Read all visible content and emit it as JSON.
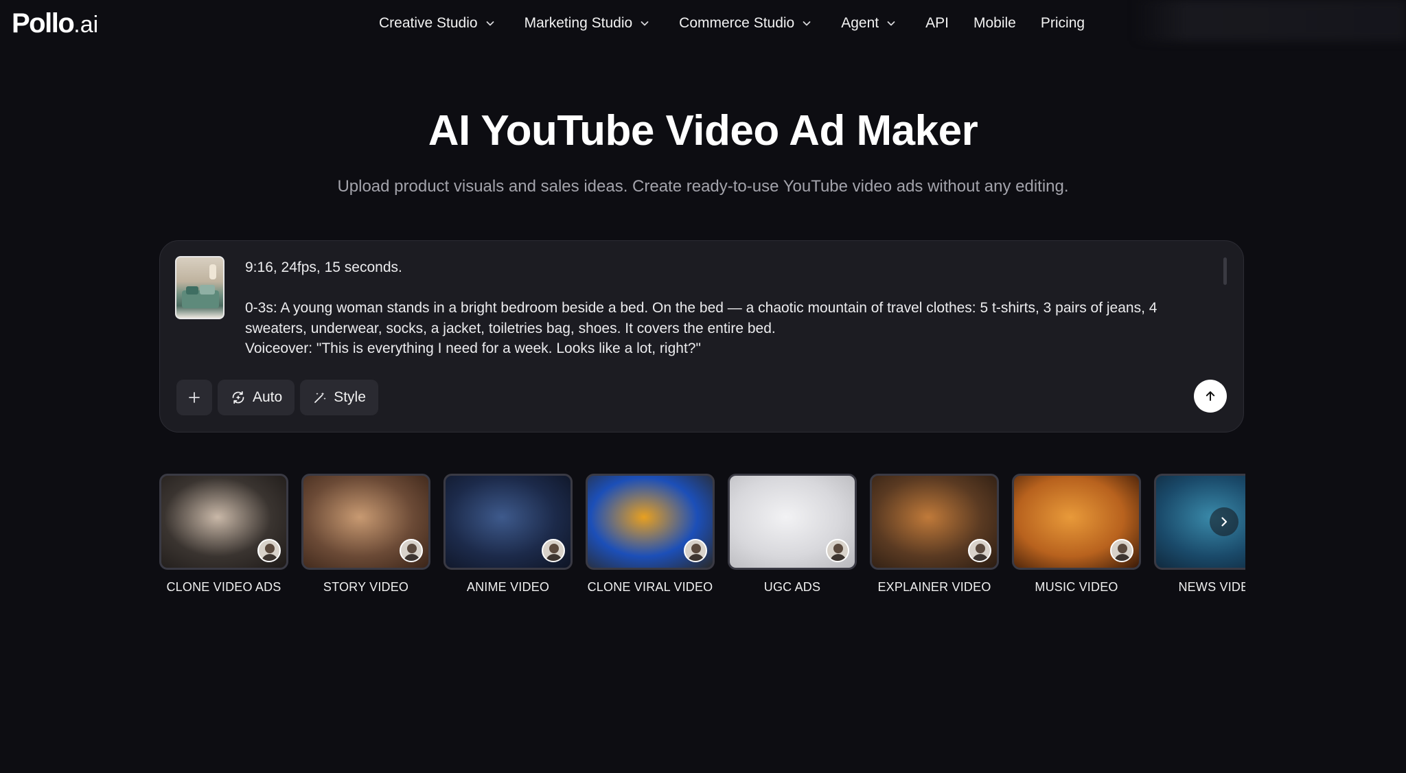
{
  "brand": {
    "name": "Pollo",
    "tld": ".ai"
  },
  "nav": {
    "items": [
      {
        "label": "Creative Studio",
        "dropdown": true
      },
      {
        "label": "Marketing Studio",
        "dropdown": true
      },
      {
        "label": "Commerce Studio",
        "dropdown": true
      },
      {
        "label": "Agent",
        "dropdown": true
      },
      {
        "label": "API",
        "dropdown": false
      },
      {
        "label": "Mobile",
        "dropdown": false
      },
      {
        "label": "Pricing",
        "dropdown": false
      }
    ]
  },
  "hero": {
    "title": "AI YouTube Video Ad Maker",
    "subtitle": "Upload product visuals and sales ideas. Create ready-to-use YouTube video ads without any editing."
  },
  "prompt": {
    "text": "9:16, 24fps, 15 seconds.\n\n0-3s: A young woman stands in a bright bedroom beside a bed. On the bed — a chaotic mountain of travel clothes: 5 t-shirts, 3 pairs of jeans, 4\nsweaters, underwear, socks, a jacket, toiletries bag, shoes. It covers the entire bed.\nVoiceover: \"This is everything I need for a week. Looks like a lot, right?\"",
    "auto_label": "Auto",
    "style_label": "Style"
  },
  "templates": [
    {
      "label": "CLONE VIDEO ADS",
      "colors": [
        "#3a3430",
        "#c9b8a8",
        "#1e1a18"
      ]
    },
    {
      "label": "STORY VIDEO",
      "colors": [
        "#6b4a36",
        "#c89a72",
        "#3a2418"
      ]
    },
    {
      "label": "ANIME VIDEO",
      "colors": [
        "#1c2a4a",
        "#3e5a8c",
        "#0e1424"
      ]
    },
    {
      "label": "CLONE VIRAL VIDEO",
      "colors": [
        "#1c4fb8",
        "#e8a020",
        "#2a2a2a"
      ]
    },
    {
      "label": "UGC ADS",
      "colors": [
        "#d8d8dc",
        "#f2f2f4",
        "#b8b8bc"
      ]
    },
    {
      "label": "EXPLAINER VIDEO",
      "colors": [
        "#5a3a22",
        "#c07a3a",
        "#2a1c12"
      ]
    },
    {
      "label": "MUSIC VIDEO",
      "colors": [
        "#b8621e",
        "#e89a3a",
        "#3a1a08"
      ]
    },
    {
      "label": "NEWS VIDEO",
      "colors": [
        "#1a4a6a",
        "#3a8aaa",
        "#0e2234"
      ]
    }
  ],
  "icons": {
    "plus": "plus-icon",
    "auto": "auto-sparkle-icon",
    "style": "magic-wand-icon",
    "send": "arrow-up-icon",
    "next": "chevron-right-icon"
  }
}
